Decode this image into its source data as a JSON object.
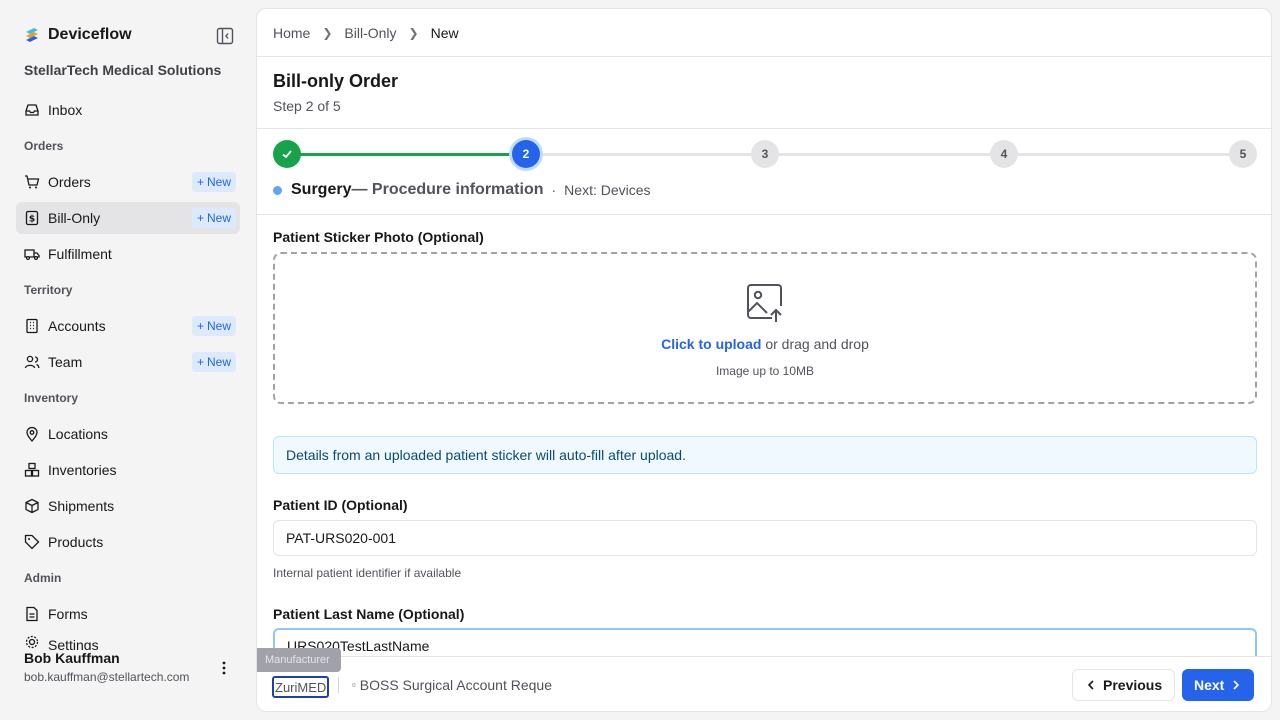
{
  "app": {
    "name": "Deviceflow",
    "org": "StellarTech Medical Solutions"
  },
  "sidebar": {
    "inbox": "Inbox",
    "orders_section": "Orders",
    "orders": "Orders",
    "bill_only": "Bill-Only",
    "fulfillment": "Fulfillment",
    "territory_section": "Territory",
    "accounts": "Accounts",
    "team": "Team",
    "inventory_section": "Inventory",
    "locations": "Locations",
    "inventories": "Inventories",
    "shipments": "Shipments",
    "products": "Products",
    "admin_section": "Admin",
    "forms": "Forms",
    "settings": "Settings",
    "new_label": "New"
  },
  "user": {
    "name": "Bob Kauffman",
    "email": "bob.kauffman@stellartech.com"
  },
  "breadcrumb": [
    "Home",
    "Bill-Only",
    "New"
  ],
  "page": {
    "title": "Bill-only Order",
    "step": "Step 2 of 5"
  },
  "stepper": {
    "steps": [
      "1",
      "2",
      "3",
      "4",
      "5"
    ],
    "current_name": "Surgery",
    "current_desc": "— Procedure information",
    "next": "Next: Devices",
    "separator": "·",
    "progress_fraction": 0.25
  },
  "form": {
    "sticker_label": "Patient Sticker Photo (Optional)",
    "upload_link": "Click to upload",
    "upload_rest": "or drag and drop",
    "upload_hint": "Image up to 10MB",
    "info": "Details from an uploaded patient sticker will auto-fill after upload.",
    "patient_id_label": "Patient ID (Optional)",
    "patient_id_value": "PAT-URS020-001",
    "patient_id_help": "Internal patient identifier if available",
    "last_name_label": "Patient Last Name (Optional)",
    "last_name_value": "URS020TestLastName"
  },
  "footer": {
    "tooltip": "Manufacturer",
    "manufacturer": "ZuriMED",
    "account": "BOSS Surgical Account Reque",
    "previous": "Previous",
    "next": "Next"
  },
  "colors": {
    "accent": "#2563eb",
    "success": "#16a34a"
  }
}
